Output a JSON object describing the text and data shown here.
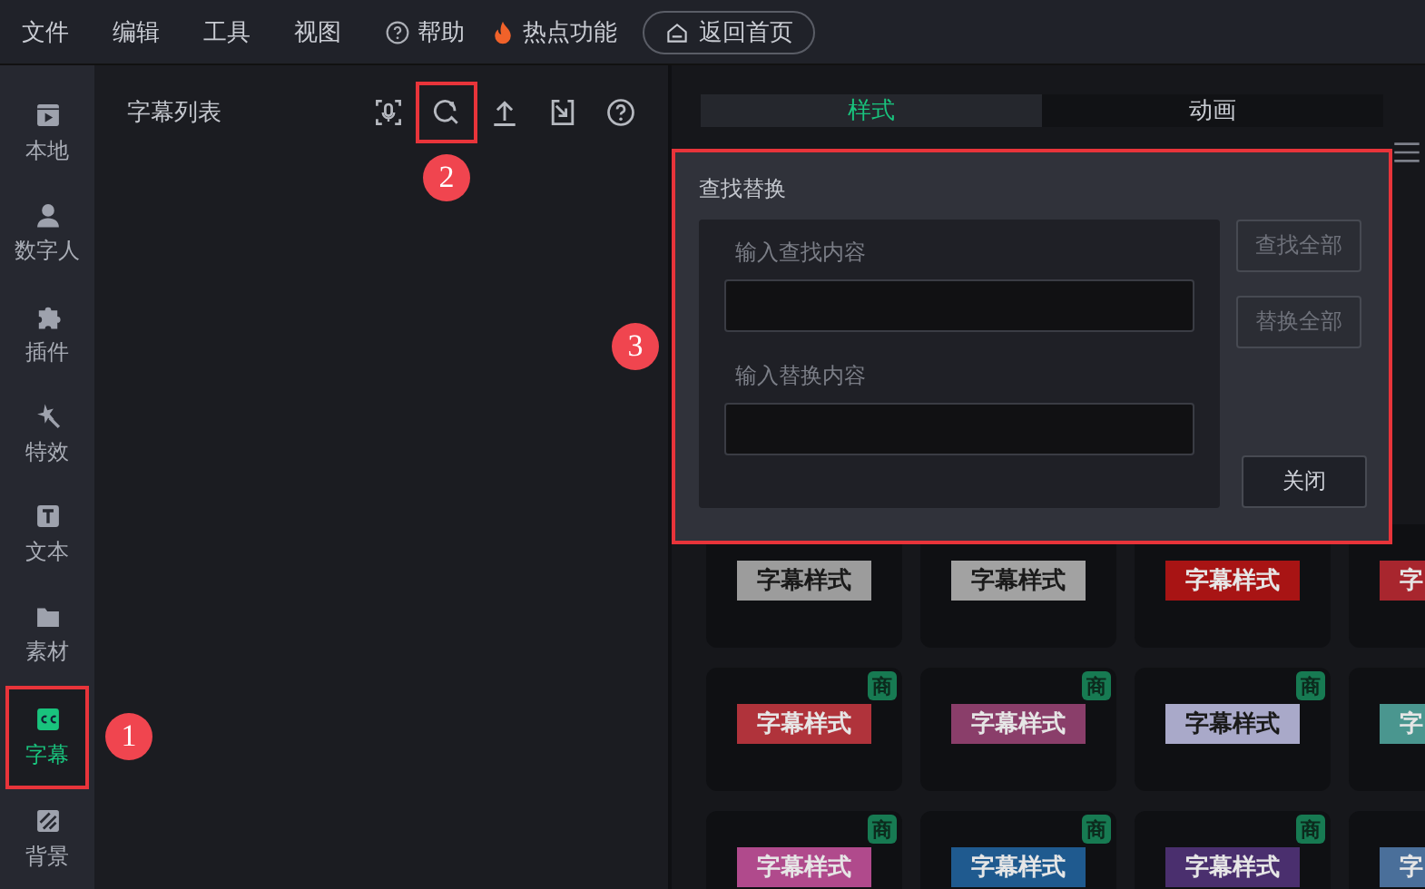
{
  "menu_bar": {
    "items": [
      "文件",
      "编辑",
      "工具",
      "视图"
    ],
    "help": {
      "label": "帮助"
    },
    "hot": {
      "label": "热点功能"
    },
    "home_button": {
      "label": "返回首页"
    }
  },
  "sidebar": {
    "items": [
      {
        "kind": "film",
        "label": "本地",
        "selected": false,
        "highlighted": false
      },
      {
        "kind": "person",
        "label": "数字人",
        "selected": false,
        "highlighted": false
      },
      {
        "kind": "puzzle",
        "label": "插件",
        "selected": false,
        "highlighted": false
      },
      {
        "kind": "magic",
        "label": "特效",
        "selected": false,
        "highlighted": false
      },
      {
        "kind": "text",
        "label": "文本",
        "selected": false,
        "highlighted": false
      },
      {
        "kind": "folder",
        "label": "素材",
        "selected": false,
        "highlighted": false
      },
      {
        "kind": "cc",
        "label": "字幕",
        "selected": true,
        "highlighted": true,
        "callout": "1"
      },
      {
        "kind": "stripes",
        "label": "背景",
        "selected": false,
        "highlighted": false
      }
    ]
  },
  "subtitle_panel": {
    "title": "字幕列表",
    "tools": [
      {
        "kind": "recognize",
        "highlighted": false
      },
      {
        "kind": "search",
        "highlighted": true,
        "callout": "2"
      },
      {
        "kind": "upload",
        "highlighted": false
      },
      {
        "kind": "import",
        "highlighted": false
      },
      {
        "kind": "help",
        "highlighted": false
      }
    ]
  },
  "style_panel": {
    "tabs": [
      {
        "label": "样式",
        "selected": true
      },
      {
        "label": "动画",
        "selected": false
      }
    ],
    "cards": [
      {
        "label": "字幕样式",
        "color": "#9c9c9c"
      },
      {
        "label": "字幕样式",
        "color": "#a2a2a2"
      },
      {
        "label": "字幕样式",
        "color": "#a81414"
      },
      {
        "label": "字",
        "color": "#a8262e"
      },
      {
        "label": "字幕样式",
        "color": "#b0333b",
        "badge": "商"
      },
      {
        "label": "字幕样式",
        "color": "#8a3e6a",
        "badge": "商"
      },
      {
        "label": "字幕样式",
        "color": "#a9a9c9",
        "badge": "商"
      },
      {
        "label": "字",
        "color": "#4a968f"
      },
      {
        "label": "字幕样式",
        "color": "#b04a8c",
        "badge": "商"
      },
      {
        "label": "字幕样式",
        "color": "#1f5a8f",
        "badge": "商"
      },
      {
        "label": "字幕样式",
        "color": "#4a2f6e",
        "badge": "商"
      },
      {
        "label": "字",
        "color": "#4a6f9a"
      }
    ]
  },
  "find_replace": {
    "title": "查找替换",
    "highlighted": true,
    "callout": "3",
    "find_label": "输入查找内容",
    "replace_label": "输入替换内容",
    "buttons": [
      {
        "kind": "find",
        "label": "查找全部",
        "disabled": true
      },
      {
        "kind": "replace",
        "label": "替换全部",
        "disabled": true
      },
      {
        "kind": "close",
        "label": "关闭",
        "disabled": false
      }
    ]
  }
}
